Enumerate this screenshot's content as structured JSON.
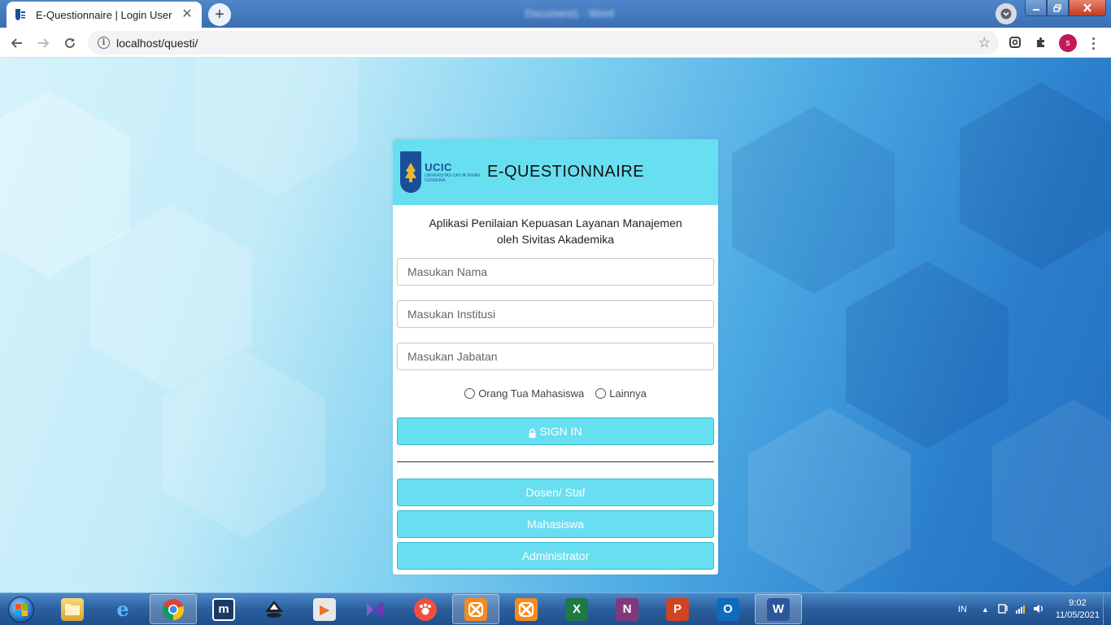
{
  "browser": {
    "tab_title": "E-Questionnaire | Login User",
    "url": "localhost/questi/",
    "window_title": "Document1 - Word",
    "profile_initial": "s"
  },
  "card": {
    "logo_text": "UCIC",
    "logo_subtext": "UNIVERSITAS CATUR INSAN CENDEKIA",
    "title": "E-QUESTIONNAIRE",
    "subtitle_line1": "Aplikasi Penilaian Kepuasan Layanan Manajemen",
    "subtitle_line2": "oleh Sivitas Akademika",
    "fields": {
      "nama_placeholder": "Masukan Nama",
      "institusi_placeholder": "Masukan Institusi",
      "jabatan_placeholder": "Masukan Jabatan"
    },
    "radio_options": [
      "Orang Tua Mahasiswa",
      "Lainnya"
    ],
    "sign_in_label": "SIGN IN",
    "role_buttons": [
      "Dosen/ Staf",
      "Mahasiswa",
      "Administrator"
    ]
  },
  "taskbar": {
    "language": "IN",
    "time": "9:02",
    "date": "11/05/2021"
  },
  "colors": {
    "card_accent": "#68dff0",
    "logo_blue": "#1b4e9a",
    "taskbar": "#2b5f9e"
  }
}
